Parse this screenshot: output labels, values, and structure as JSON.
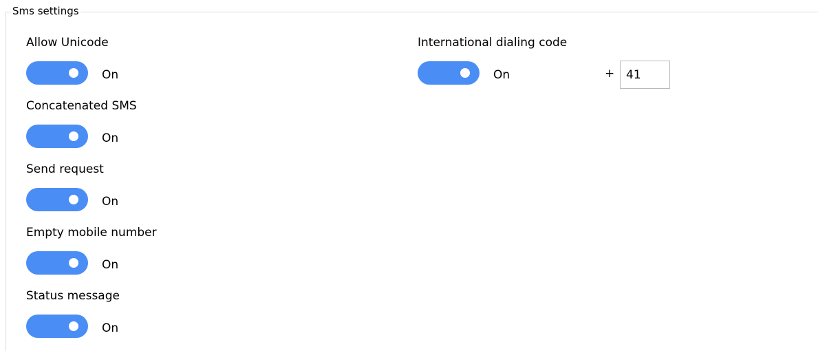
{
  "group": {
    "title": "Sms settings"
  },
  "settings": [
    {
      "label": "Allow Unicode",
      "state": "On",
      "enabled": true
    },
    {
      "label": "Concatenated SMS",
      "state": "On",
      "enabled": true
    },
    {
      "label": "Send request",
      "state": "On",
      "enabled": true
    },
    {
      "label": "Empty mobile number",
      "state": "On",
      "enabled": true
    },
    {
      "label": "Status message",
      "state": "On",
      "enabled": true
    }
  ],
  "international": {
    "label": "International dialing code",
    "state": "On",
    "enabled": true,
    "prefix": "+",
    "code": "41"
  },
  "colors": {
    "toggle_on": "#4a8ef5",
    "border": "#dcdcdc"
  }
}
